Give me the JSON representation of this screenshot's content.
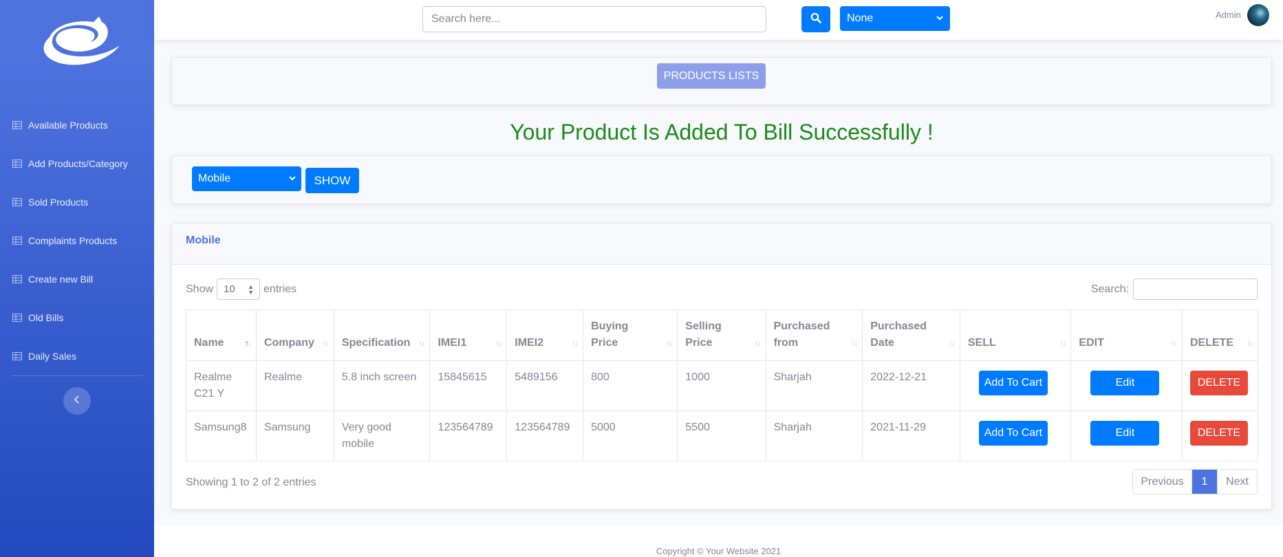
{
  "sidebar": {
    "items": [
      {
        "label": "Available Products"
      },
      {
        "label": "Add Products/Category"
      },
      {
        "label": "Sold Products"
      },
      {
        "label": "Complaints Products"
      },
      {
        "label": "Create new Bill"
      },
      {
        "label": "Old Bills"
      },
      {
        "label": "Daily Sales"
      }
    ]
  },
  "topbar": {
    "search_placeholder": "Search here...",
    "select_value": "None",
    "user_name": "Admin"
  },
  "header_card": {
    "button_label": "PRODUCTS LISTS"
  },
  "message": "Your Product Is Added To Bill Successfully !",
  "filter": {
    "category_value": "Mobile",
    "show_label": "SHOW"
  },
  "table_card": {
    "title": "Mobile",
    "show_label": "Show",
    "entries_value": "10",
    "entries_label": "entries",
    "search_label": "Search:",
    "columns": [
      "Name",
      "Company",
      "Specification",
      "IMEI1",
      "IMEI2",
      "Buying Price",
      "Selling Price",
      "Purchased from",
      "Purchased Date",
      "SELL",
      "EDIT",
      "DELETE"
    ],
    "rows": [
      {
        "name": "Realme C21 Y",
        "company": "Realme",
        "spec": "5.8 inch screen",
        "imei1": "15845615",
        "imei2": "5489156",
        "buy": "800",
        "sell": "1000",
        "from": "Sharjah",
        "date": "2022-12-21",
        "cart": "Add To Cart",
        "edit": "Edit",
        "delete": "DELETE"
      },
      {
        "name": "Samsung8",
        "company": "Samsung",
        "spec": "Very good mobile",
        "imei1": "123564789",
        "imei2": "123564789",
        "buy": "5000",
        "sell": "5500",
        "from": "Sharjah",
        "date": "2021-11-29",
        "cart": "Add To Cart",
        "edit": "Edit",
        "delete": "DELETE"
      }
    ],
    "info": "Showing 1 to 2 of 2 entries",
    "pagination": {
      "previous": "Previous",
      "current": "1",
      "next": "Next"
    }
  },
  "footer": {
    "copyright": "Copyright © Your Website 2021"
  },
  "colors": {
    "primary": "#4e73df",
    "button": "#007bff",
    "danger": "#e74a3b",
    "success_text": "#1b8a1b"
  }
}
